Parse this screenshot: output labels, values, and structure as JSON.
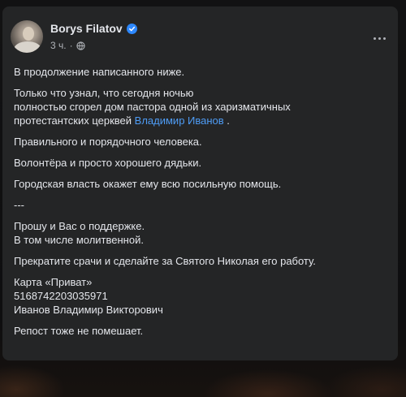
{
  "post": {
    "author": "Borys Filatov",
    "time": "3 ч.",
    "separator": "·",
    "paragraphs": {
      "p1": "В продолжение написанного ниже.",
      "p2_line1": "Только что узнал, что сегодня ночью",
      "p2_line2": "полностью сгорел дом пастора одной из харизматичных",
      "p2_line3_pre": "протестантских церквей ",
      "p2_mention": "Владимир Иванов",
      "p2_line3_post": " .",
      "p3": "Правильного и порядочного человека.",
      "p4": "Волонтёра и просто хорошего дядьки.",
      "p5": "Городская власть окажет ему всю посильную помощь.",
      "p6": "---",
      "p7_line1": "Прошу и Вас о поддержке.",
      "p7_line2": "В том числе молитвенной.",
      "p8": "Прекратите срачи и сделайте за Святого Николая его работу.",
      "p9_line1": "Карта «Приват»",
      "p9_line2": "5168742203035971",
      "p9_line3": "Иванов Владимир Викторович",
      "p10": "Репост тоже не помешает."
    }
  },
  "colors": {
    "card": "#242526",
    "text": "#e4e6eb",
    "secondary_text": "#b0b3b8",
    "link": "#4e9cf5",
    "verified": "#2d88ff"
  },
  "icons": {
    "verified": "verified-badge-icon",
    "audience": "globe-icon",
    "menu": "more-options-icon"
  }
}
